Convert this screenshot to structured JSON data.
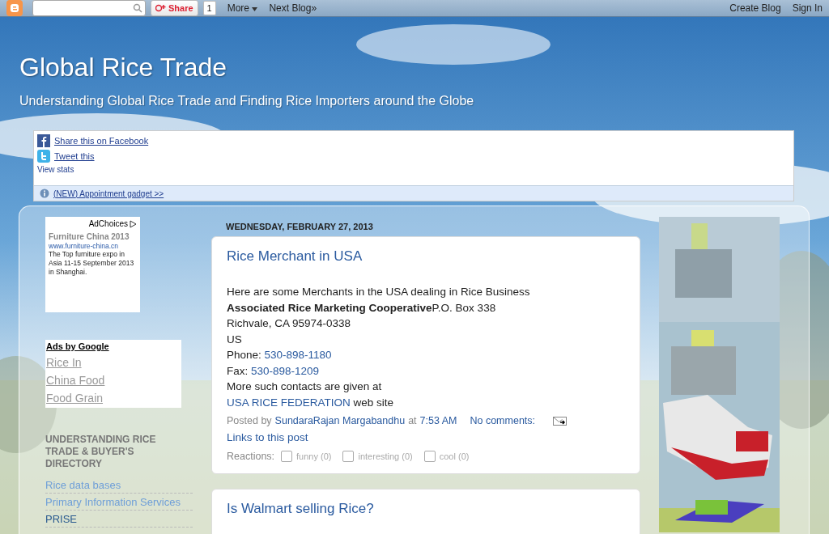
{
  "navbar": {
    "share_button": "Share",
    "share_count": "1",
    "more": "More",
    "next_blog": "Next Blog»",
    "create_blog": "Create Blog",
    "sign_in": "Sign In"
  },
  "header": {
    "title": "Global Rice Trade",
    "description": "Understanding Global Rice Trade and Finding Rice Importers around the Globe"
  },
  "share_box": {
    "links": [
      {
        "kind": "facebook",
        "label": "Share this on Facebook"
      },
      {
        "kind": "twitter",
        "label": "Tweet this"
      }
    ],
    "view_stats": "View stats",
    "notice": "(NEW) Appointment gadget >>"
  },
  "sidebar": {
    "ad": {
      "adchoices": "AdChoices",
      "title": "Furniture China 2013",
      "url": "www.furniture-china.cn",
      "text": "The Top furniture expo in Asia 11-15 September 2013 in Shanghai."
    },
    "ads_by_google": {
      "heading": "Ads by Google",
      "links": [
        "Rice In",
        "China Food",
        "Food Grain"
      ]
    },
    "section": {
      "heading": "UNDERSTANDING RICE TRADE & BUYER'S DIRECTORY",
      "links": [
        {
          "label": "Rice data bases",
          "visited": false
        },
        {
          "label": "Primary Information Services",
          "visited": false
        },
        {
          "label": "PRISE",
          "visited": true
        }
      ]
    }
  },
  "date_header": "WEDNESDAY, FEBRUARY 27, 2013",
  "posts": [
    {
      "title": "Rice Merchant in USA",
      "lines": [
        "Here are some Merchants in the USA dealing in Rice Business",
        "**Associated Rice Marketing Cooperative**P.O. Box 338",
        "Richvale, CA 95974-0338",
        "US"
      ],
      "phone_label": "Phone: ",
      "phone": "530-898-1180",
      "fax_label": "Fax: ",
      "fax": "530-898-1209",
      "more_text": "More such contacts are given at",
      "federation_link": "USA RICE FEDERATION",
      "federation_suffix": " web site",
      "posted_by": "Posted by",
      "author": "SundaraRajan Margabandhu",
      "at": "at",
      "time": "7:53 AM",
      "comments": "No comments:",
      "backlinks": "Links to this post",
      "reactions_label": "Reactions:",
      "reactions": [
        {
          "label": "funny (0)",
          "checked": false
        },
        {
          "label": "interesting (0)",
          "checked": false
        },
        {
          "label": "cool (0)",
          "checked": false
        }
      ]
    },
    {
      "title": "Is Walmart selling Rice?"
    }
  ]
}
